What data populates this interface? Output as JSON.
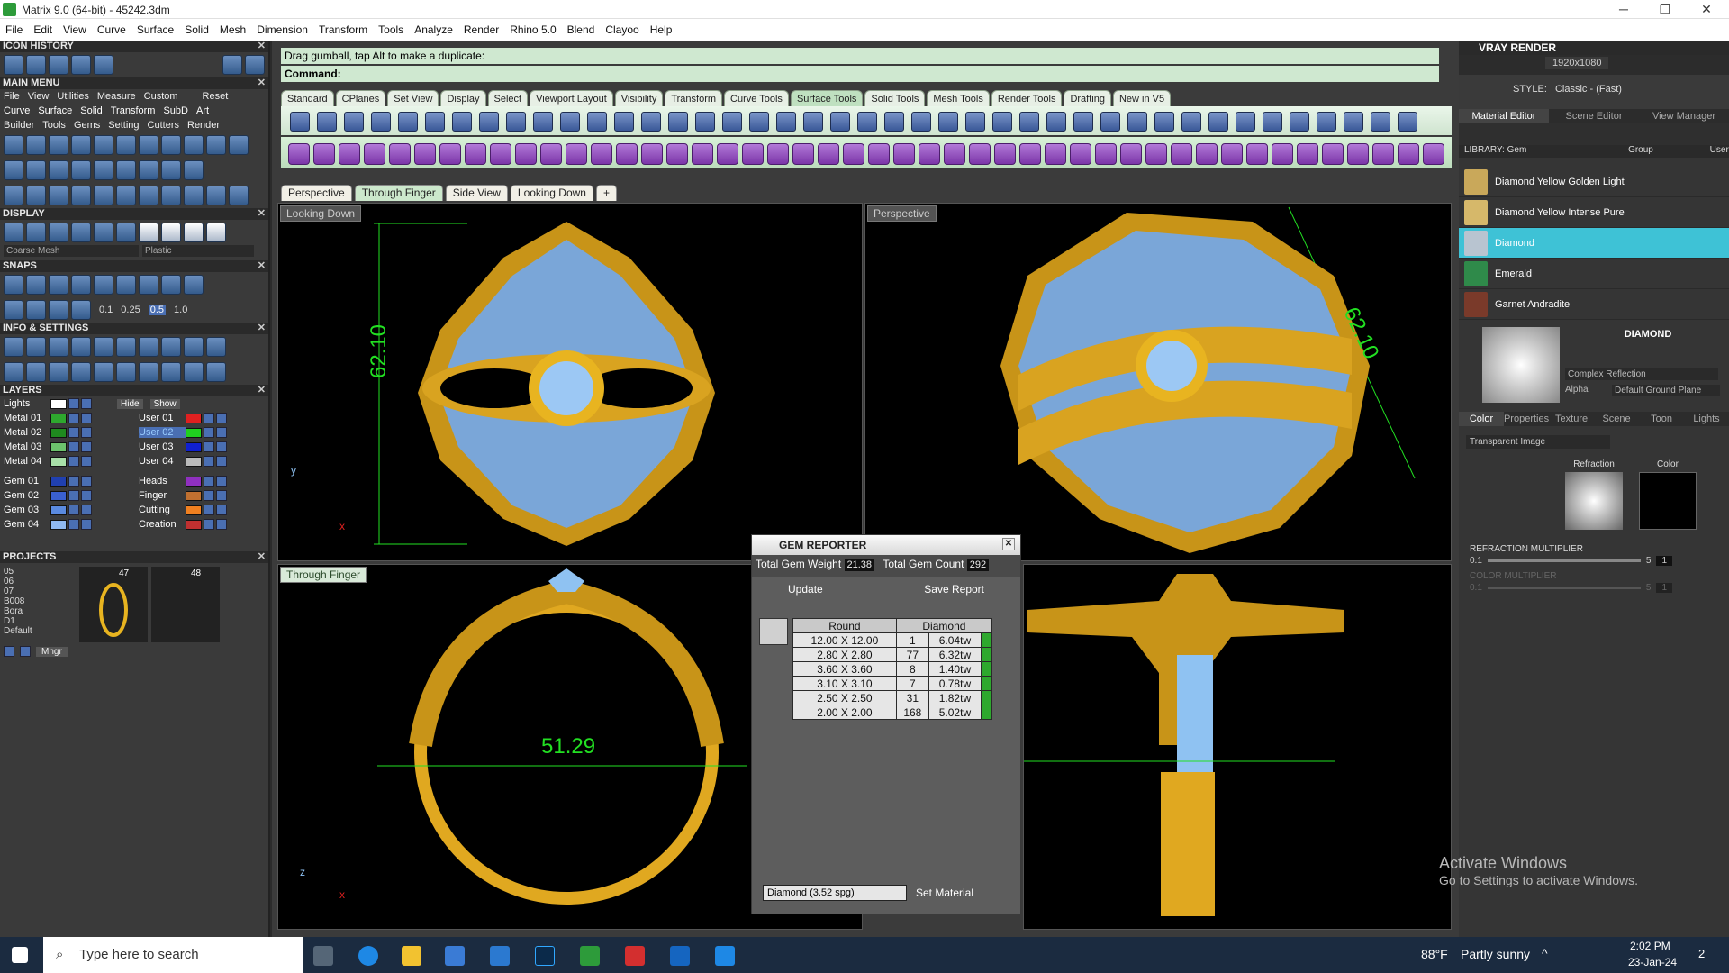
{
  "window": {
    "title": "Matrix 9.0 (64-bit) - 45242.3dm"
  },
  "menubar": [
    "File",
    "Edit",
    "View",
    "Curve",
    "Surface",
    "Solid",
    "Mesh",
    "Dimension",
    "Transform",
    "Tools",
    "Analyze",
    "Render",
    "Rhino 5.0",
    "Blend",
    "Clayoo",
    "Help"
  ],
  "left": {
    "icon_history": "ICON HISTORY",
    "main_menu": "MAIN MENU",
    "main_menu_top": [
      "File",
      "View",
      "Utilities",
      "Measure",
      "Custom",
      "Reset"
    ],
    "main_menu_row2": [
      "Curve",
      "Surface",
      "Solid",
      "Transform",
      "SubD",
      "Art"
    ],
    "main_menu_row3": [
      "Builder",
      "Tools",
      "Gems",
      "Setting",
      "Cutters",
      "Render"
    ],
    "display": "DISPLAY",
    "display_left": "Coarse Mesh",
    "display_right": "Plastic",
    "snaps": "SNAPS",
    "snap_values": [
      "0.1",
      "0.25",
      "0.5",
      "1.0"
    ],
    "info": "INFO & SETTINGS",
    "layers": "LAYERS",
    "layer_lights": "Lights",
    "layer_hide": "Hide",
    "layer_show": "Show",
    "layers_left": [
      "Metal 01",
      "Metal 02",
      "Metal 03",
      "Metal 04",
      "Gem 01",
      "Gem 02",
      "Gem 03",
      "Gem 04"
    ],
    "layers_right": [
      "User 01",
      "User 02",
      "User 03",
      "User 04",
      "Heads",
      "Finger",
      "Cutting",
      "Creation"
    ],
    "projects": "PROJECTS",
    "project_list": [
      "05",
      "06",
      "07",
      "B008",
      "Bora",
      "D1",
      "Default"
    ],
    "project_nums": [
      "47",
      "48"
    ],
    "mngr": "Mngr"
  },
  "command": {
    "prompt": "Drag gumball, tap Alt to make a duplicate:",
    "label": "Command:"
  },
  "tooltabs": [
    "Standard",
    "CPlanes",
    "Set View",
    "Display",
    "Select",
    "Viewport Layout",
    "Visibility",
    "Transform",
    "Curve Tools",
    "Surface Tools",
    "Solid Tools",
    "Mesh Tools",
    "Render Tools",
    "Drafting",
    "New in V5"
  ],
  "viewtabs": [
    "Perspective",
    "Through Finger",
    "Side View",
    "Looking Down"
  ],
  "viewports": {
    "tl_label": "Looking Down",
    "tr_label": "Perspective",
    "bl_label": "Through Finger",
    "dim_vertical": "62.10",
    "dim_diag": "62.10",
    "dim_horizontal": "51.29"
  },
  "gem_reporter": {
    "title": "GEM REPORTER",
    "weight_label": "Total Gem Weight",
    "weight_value": "21.38",
    "count_label": "Total Gem Count",
    "count_value": "292",
    "update": "Update",
    "save": "Save Report",
    "header_shape": "Round",
    "header_material": "Diamond",
    "rows": [
      {
        "size": "12.00 X 12.00",
        "count": "1",
        "weight": "6.04tw"
      },
      {
        "size": "2.80 X 2.80",
        "count": "77",
        "weight": "6.32tw"
      },
      {
        "size": "3.60 X 3.60",
        "count": "8",
        "weight": "1.40tw"
      },
      {
        "size": "3.10 X 3.10",
        "count": "7",
        "weight": "0.78tw"
      },
      {
        "size": "2.50 X 2.50",
        "count": "31",
        "weight": "1.82tw"
      },
      {
        "size": "2.00 X 2.00",
        "count": "168",
        "weight": "5.02tw"
      }
    ],
    "material_select": "Diamond     (3.52 spg)",
    "set_material": "Set Material"
  },
  "vray": {
    "title": "VRAY RENDER",
    "resolution": "1920x1080",
    "style_label": "STYLE:",
    "style_value": "Classic - (Fast)",
    "tabs": [
      "Material Editor",
      "Scene Editor",
      "View Manager"
    ],
    "library_label": "LIBRARY: Gem",
    "library_group": "Group",
    "library_user": "User",
    "materials": [
      "Diamond Yellow Golden Light",
      "Diamond Yellow Intense Pure",
      "Diamond",
      "Emerald",
      "Garnet Andradite"
    ],
    "selected_name": "DIAMOND",
    "reflection": "Complex Reflection",
    "alpha": "Alpha",
    "ground": "Default Ground Plane",
    "subtabs": [
      "Color",
      "Properties",
      "Texture",
      "Scene",
      "Toon",
      "Lights"
    ],
    "transparent": "Transparent Image",
    "refraction": "Refraction",
    "color": "Color",
    "refraction_mult": "REFRACTION MULTIPLIER",
    "color_mult": "COLOR MULTIPLIER",
    "mult_min": "0.1",
    "mult_max": "5",
    "mult_val": "1"
  },
  "watermark": {
    "line1": "Activate Windows",
    "line2": "Go to Settings to activate Windows."
  },
  "taskbar": {
    "search": "Type here to search",
    "weather_temp": "88°F",
    "weather_desc": "Partly sunny",
    "time": "2:02 PM",
    "date": "23-Jan-24",
    "notif": "2"
  },
  "colors": {
    "accent_green": "#22e022",
    "gem_blue": "#8fc2f2",
    "gold": "#e8b420",
    "selected_cyan": "#3ec2d6"
  }
}
